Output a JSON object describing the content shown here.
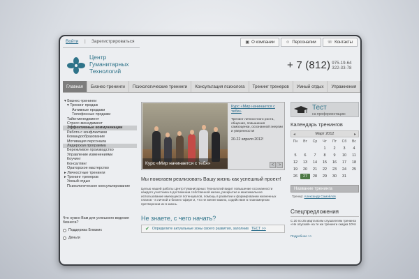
{
  "topbar": {
    "login": "Войти",
    "separator": "|",
    "register": "Зарегистрироваться"
  },
  "topnav": [
    {
      "label": "О компании",
      "icon": "briefcase-icon"
    },
    {
      "label": "Персоналии",
      "icon": "person-icon"
    },
    {
      "label": "Контакты",
      "icon": "contacts-icon"
    }
  ],
  "logo": {
    "line1": "Центр",
    "line2": "Гуманитарных",
    "line3": "Технологий",
    "color": "#2e7389"
  },
  "phone": {
    "main": "+ 7 (812)",
    "num1": "975-19-64",
    "num2": "322-33-78"
  },
  "mainnav": [
    {
      "label": "Главная",
      "active": true
    },
    {
      "label": "Бизнес-тренинги"
    },
    {
      "label": "Психологические тренинги"
    },
    {
      "label": "Консультация психолога"
    },
    {
      "label": "Тренинг тренеров"
    },
    {
      "label": "Умный отдых"
    },
    {
      "label": "Упражнения"
    }
  ],
  "leftmenu": [
    {
      "label": "▾ Бизнес-тренинги",
      "level": 0
    },
    {
      "label": "▾ Тренинг продаж",
      "level": 1
    },
    {
      "label": "Активные продажи",
      "level": 2
    },
    {
      "label": "Телефонные продажи",
      "level": 2
    },
    {
      "label": "Тайм-менеджмент",
      "level": 1
    },
    {
      "label": "Стресс-менеджмент",
      "level": 1
    },
    {
      "label": "Эффективные коммуникации",
      "level": 1,
      "bold": true,
      "highlight": true
    },
    {
      "label": "Работа с конфликтами",
      "level": 1
    },
    {
      "label": "Командообразование",
      "level": 1
    },
    {
      "label": "Мотивация персонала",
      "level": 1
    },
    {
      "label": "Лидерская программа",
      "level": 1,
      "highlight": true
    },
    {
      "label": "Бережливое производство",
      "level": 1
    },
    {
      "label": "Управление изменениями",
      "level": 1
    },
    {
      "label": "Коучинг",
      "level": 1
    },
    {
      "label": "Консалтинг",
      "level": 1
    },
    {
      "label": "Ораторское мастерство",
      "level": 1
    },
    {
      "label": "▸ Личностные тренинги",
      "level": 0
    },
    {
      "label": "▸ Тренинг тренеров",
      "level": 0
    },
    {
      "label": "Умный отдых",
      "level": 1
    },
    {
      "label": "Психологическое консультирование",
      "level": 1
    }
  ],
  "poll": {
    "question": "Что нужно Вам для успешного ведения бизнеса?",
    "options": [
      "Поддержка Близких",
      "Деньги"
    ]
  },
  "slider": {
    "caption": "Курс «Мир начинается с тебя»",
    "title": "Курс «Мир начинается с тебя»",
    "description": "Тренинг личностного роста, общения, повышения самооценки, осознанной энергии и уверенности!",
    "date": "20-22 апреля 2012!",
    "prev": "<",
    "next": ">"
  },
  "headline": "Мы помогаем реализовать Вашу жизнь как успешный проект!",
  "intro": "Целью нашей работы Центр Гуманитарных Технологий видит повышение осознанности каждого участника в достижении собственной жизни, раскрытие и максимальное использование имеющихся потенциалов, помощь в развитии и формировании жизненных планов - в личной и бизнес-сфере и, что не менее важно, содействие в планомерном претворении их в жизнь.",
  "question": "Не знаете, с чего начать?",
  "cta": {
    "prefix": "Определите актуальные зоны своего развития, заполнив",
    "link": "ТЕСТ >>"
  },
  "test_box": {
    "title": "Тест",
    "subtitle": "на профориентацию"
  },
  "calendar": {
    "title": "Календарь тренингов",
    "month": "Март 2012",
    "prev": "◂",
    "next": "▸",
    "dow": [
      "Пн",
      "Вт",
      "Ср",
      "Чт",
      "Пт",
      "Сб",
      "Вс"
    ],
    "leading_blank": 3,
    "days": 31,
    "highlight_day": 27
  },
  "training_field": "Название тренинга",
  "trainer": {
    "label": "Тренер:",
    "name": "Александр Самойлов"
  },
  "special": {
    "title": "Спецпредложения",
    "text": "С 20 по 25 марта всем слушателям тренинга «Не опускай» на те же тренинги скидка 10%!",
    "more": "Подробнее >>"
  }
}
